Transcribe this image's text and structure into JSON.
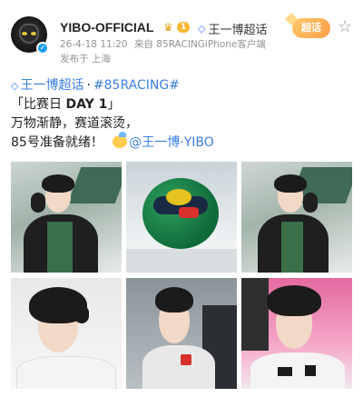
{
  "author": {
    "username": "YIBO-OFFICIAL",
    "vip_level": "1",
    "supertopic": "王一博超话",
    "timestamp": "26-4-18 11:20",
    "source_prefix": "来自",
    "source": "85RACINGiPhone客户端",
    "location": "发布于 上海"
  },
  "actions": {
    "supertopic_button": "超话"
  },
  "post": {
    "topic_1": "王一博超话",
    "separator": "·",
    "topic_2": "#85RACING#",
    "line_2_open": "「比赛日 ",
    "line_2_bold": "DAY 1",
    "line_2_close": "」",
    "line_3": "万物渐静，赛道滚烫，",
    "line_4": "85号准备就绪！",
    "mention": "@王一博·YIBO"
  },
  "photos": [
    {
      "alt": "driver adjusting suit"
    },
    {
      "alt": "racing helmet"
    },
    {
      "alt": "driver adjusting suit near car"
    },
    {
      "alt": "driver portrait"
    },
    {
      "alt": "driver side profile"
    },
    {
      "alt": "driver close up"
    }
  ],
  "colors": {
    "link_blue": "#3b7fe0",
    "meta_gray": "#939393",
    "vip_gold": "#f7b731"
  }
}
